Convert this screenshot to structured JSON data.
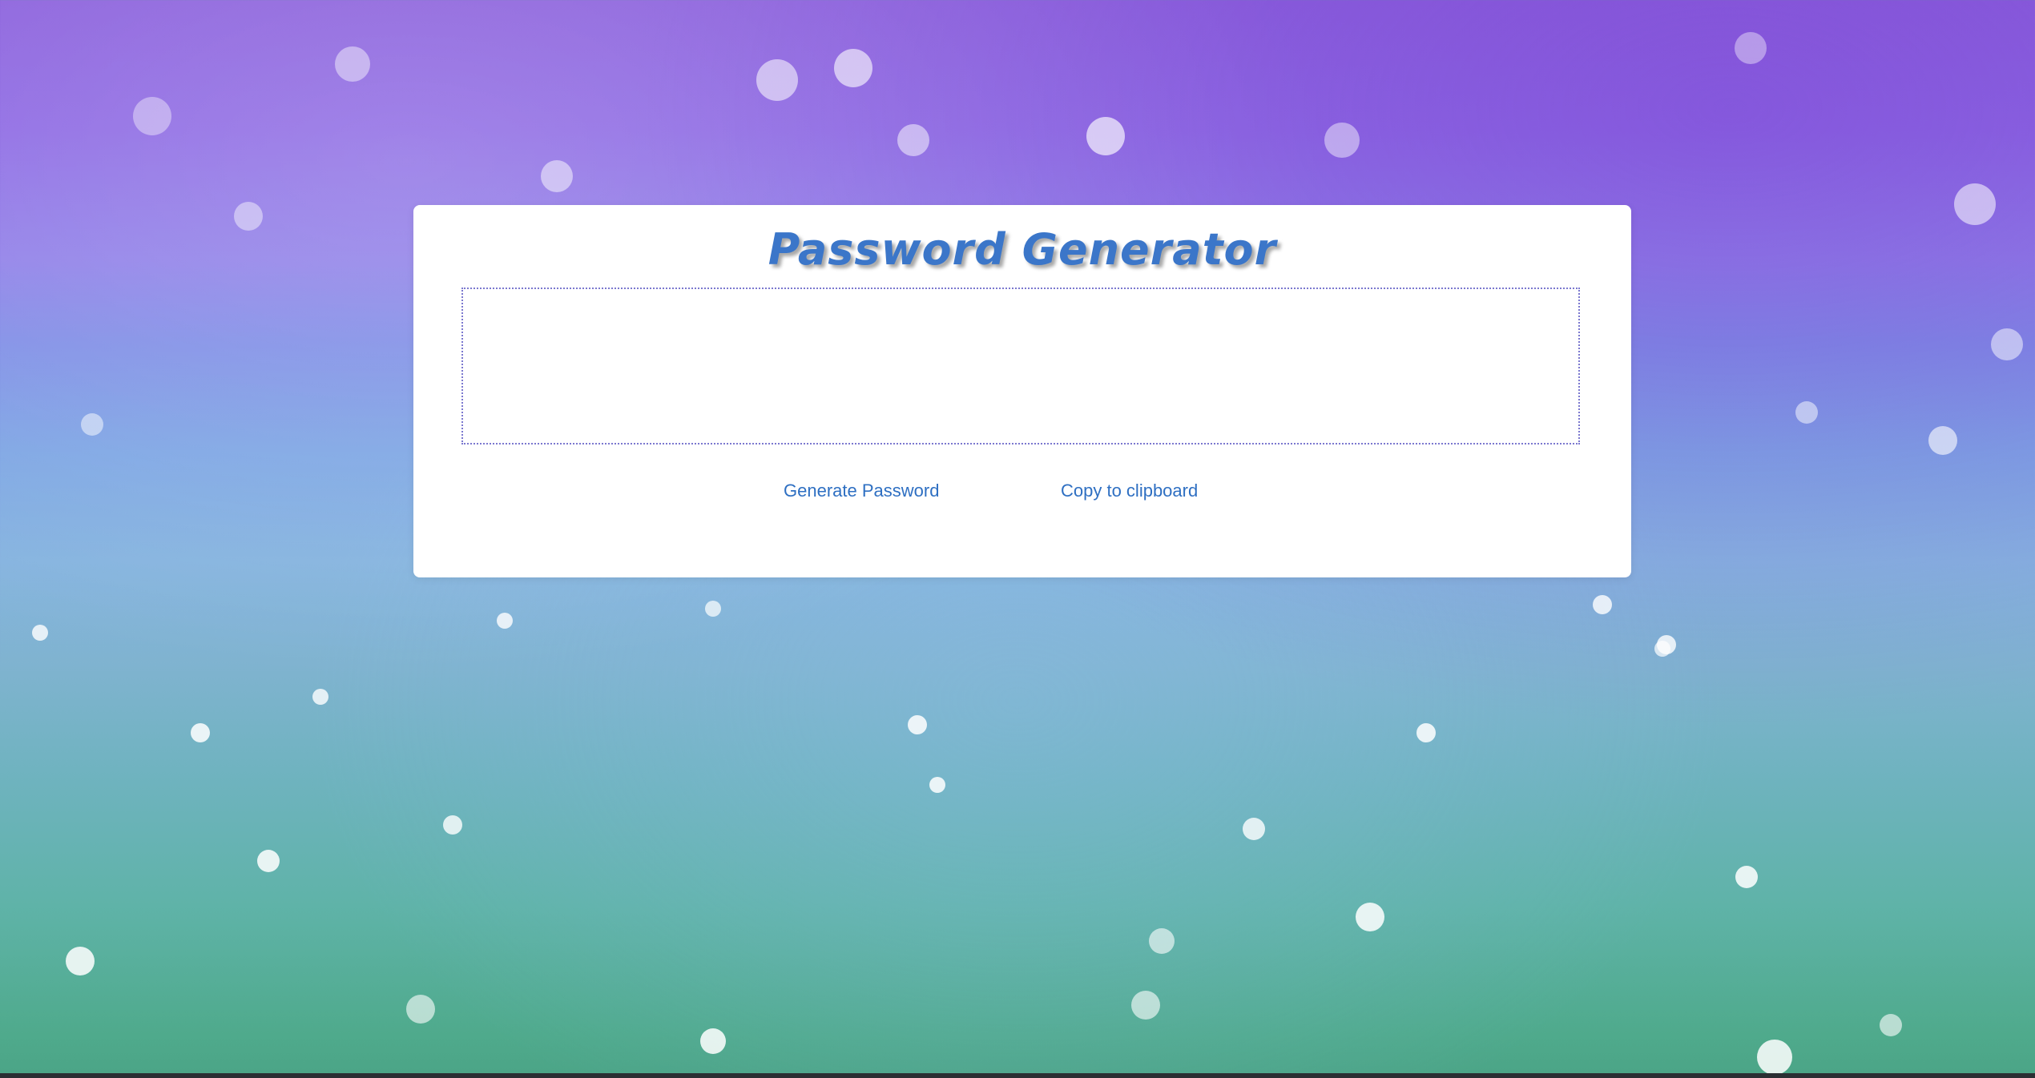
{
  "page": {
    "title": "Password Generator"
  },
  "password": {
    "value": "",
    "placeholder": ""
  },
  "buttons": {
    "generate_label": "Generate Password",
    "copy_label": "Copy to clipboard"
  },
  "colors": {
    "accent": "#3b76c9",
    "link": "#2e6fc2",
    "box_border": "#7b78cf",
    "card_bg": "#ffffff"
  }
}
